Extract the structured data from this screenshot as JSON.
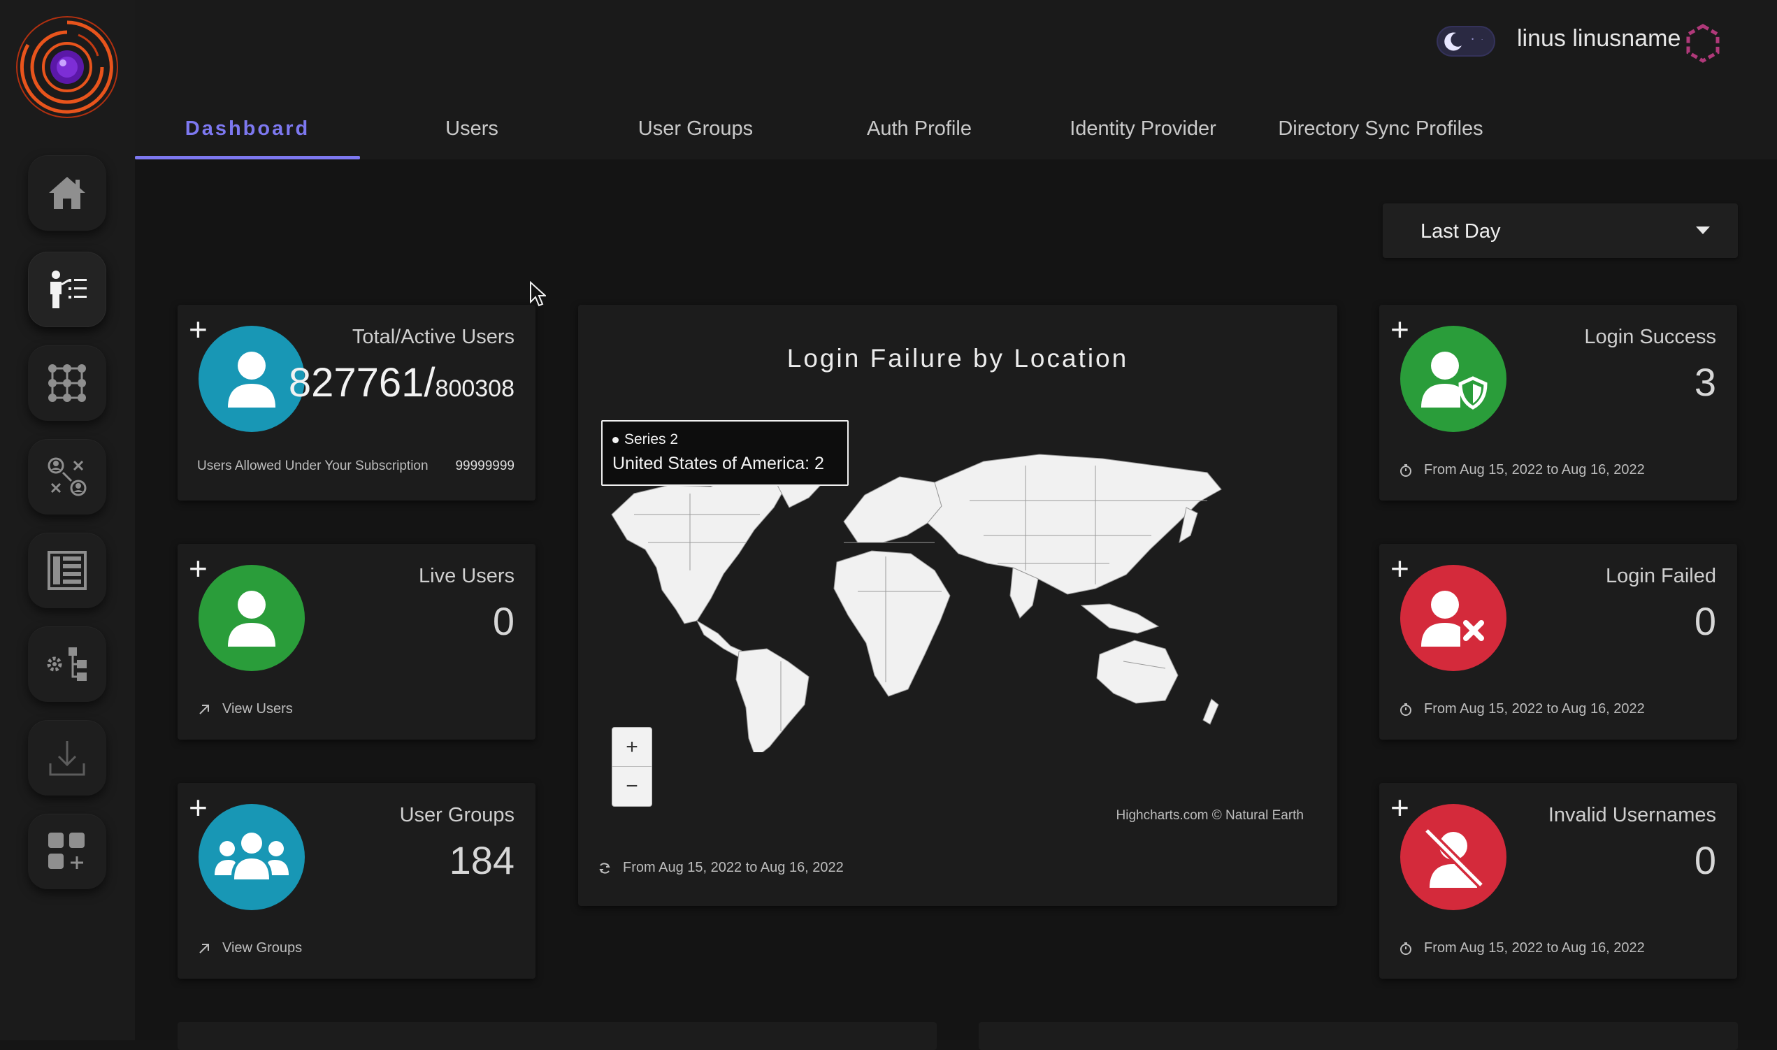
{
  "header": {
    "user_name": "linus linusname",
    "tabs": [
      {
        "label": "Dashboard",
        "active": true
      },
      {
        "label": "Users"
      },
      {
        "label": "User Groups"
      },
      {
        "label": "Auth Profile"
      },
      {
        "label": "Identity Provider"
      },
      {
        "label": "Directory Sync Profiles"
      }
    ]
  },
  "sidebar": {
    "items": [
      {
        "icon": "home-icon"
      },
      {
        "icon": "user-list-icon",
        "active": true
      },
      {
        "icon": "grid-dots-icon"
      },
      {
        "icon": "user-network-icon"
      },
      {
        "icon": "list-panel-icon"
      },
      {
        "icon": "settings-tree-icon"
      },
      {
        "icon": "download-icon"
      },
      {
        "icon": "add-app-icon"
      }
    ]
  },
  "filter": {
    "time_range": "Last Day"
  },
  "cards": {
    "total_users": {
      "title": "Total/Active Users",
      "total": "827761/",
      "active": "800308",
      "foot_label": "Users Allowed Under Your Subscription",
      "foot_value": "99999999"
    },
    "live_users": {
      "title": "Live Users",
      "value": "0",
      "link": "View Users"
    },
    "user_groups": {
      "title": "User Groups",
      "value": "184",
      "link": "View Groups"
    },
    "login_success": {
      "title": "Login Success",
      "value": "3",
      "range": "From Aug 15, 2022 to Aug 16, 2022"
    },
    "login_failed": {
      "title": "Login Failed",
      "value": "0",
      "range": "From Aug 15, 2022 to Aug 16, 2022"
    },
    "invalid_usernames": {
      "title": "Invalid Usernames",
      "value": "0",
      "range": "From Aug 15, 2022 to Aug 16, 2022"
    }
  },
  "map": {
    "title": "Login Failure by Location",
    "tooltip_series": "Series 2",
    "tooltip_value": "United States of America: 2",
    "zoom_in": "+",
    "zoom_out": "−",
    "credit": "Highcharts.com © Natural Earth",
    "range": "From Aug 15, 2022 to Aug 16, 2022"
  },
  "colors": {
    "accent": "#7d78f0",
    "teal": "#1897b5",
    "green": "#2a9d3a",
    "red": "#d42a3b"
  }
}
